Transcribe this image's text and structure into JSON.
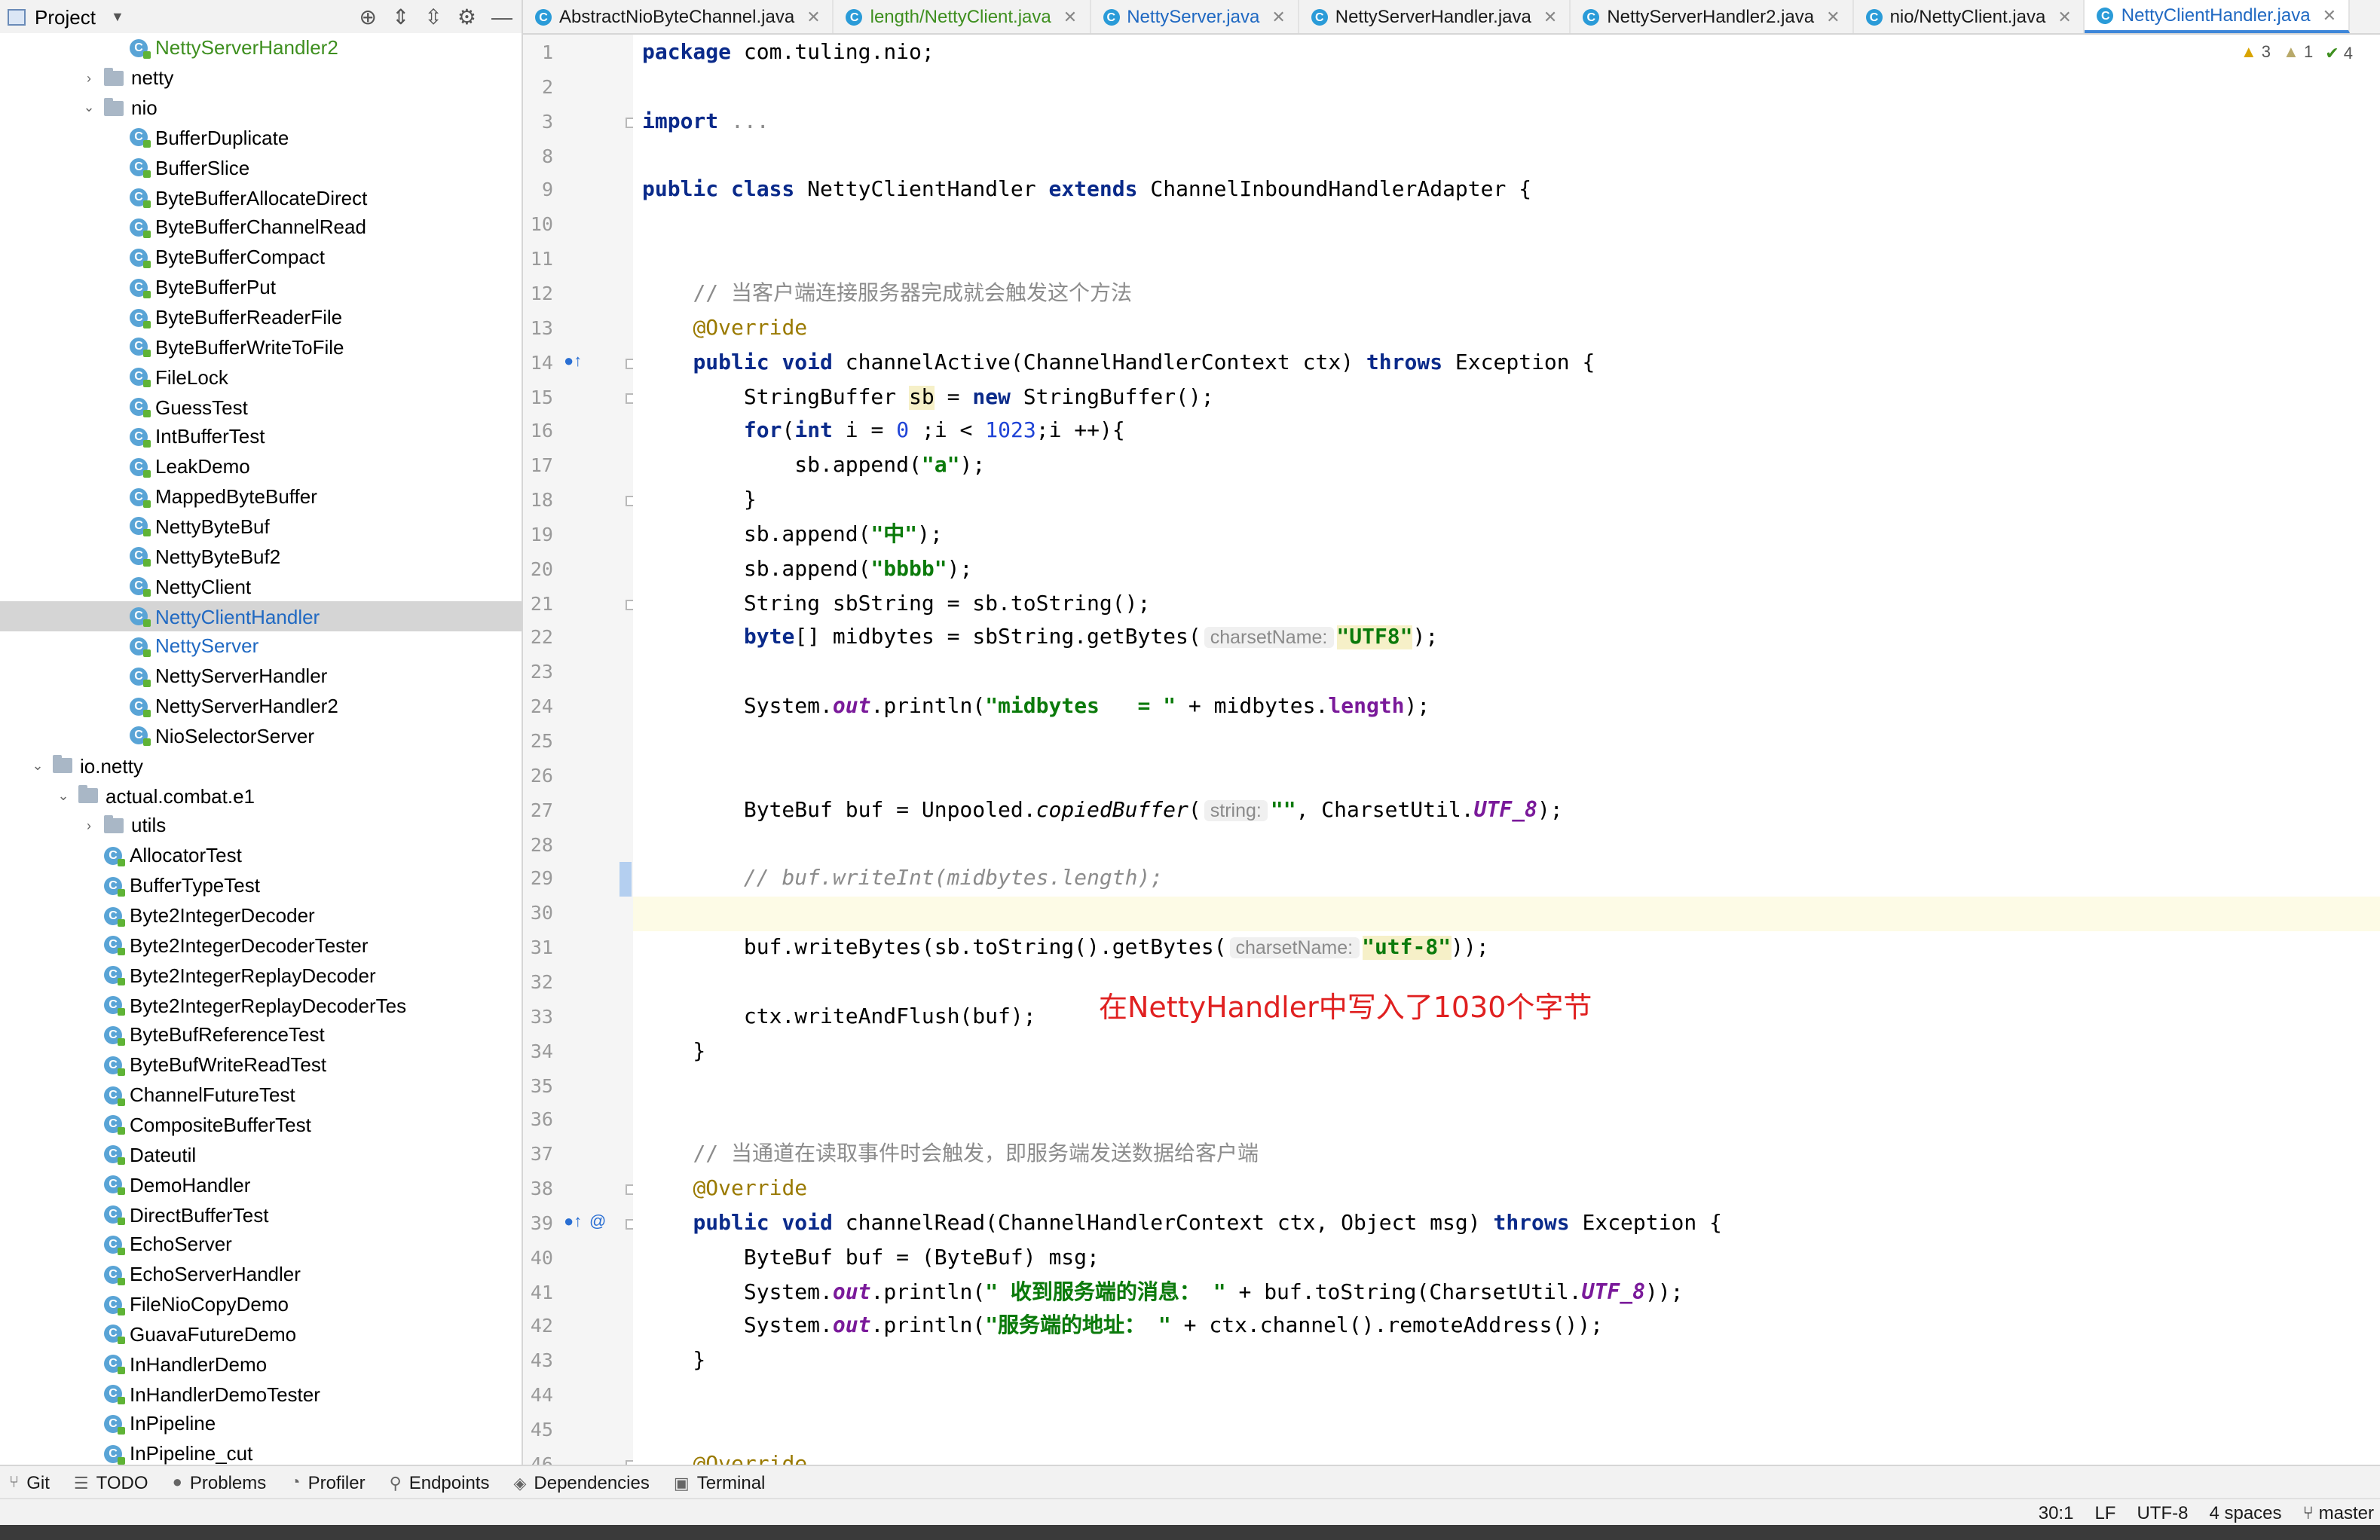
{
  "project_panel": {
    "title": "Project"
  },
  "tabs": [
    {
      "label": "AbstractNioByteChannel.java",
      "color": "normal"
    },
    {
      "label": "length/NettyClient.java",
      "color": "green"
    },
    {
      "label": "NettyServer.java",
      "color": "blue"
    },
    {
      "label": "NettyServerHandler.java",
      "color": "normal"
    },
    {
      "label": "NettyServerHandler2.java",
      "color": "normal"
    },
    {
      "label": "nio/NettyClient.java",
      "color": "normal"
    },
    {
      "label": "NettyClientHandler.java",
      "color": "active"
    }
  ],
  "tree": [
    {
      "label": "NettyServerHandler2",
      "kind": "class",
      "depth": 4,
      "color": "green"
    },
    {
      "label": "netty",
      "kind": "folder",
      "depth": 3,
      "arrow": "collapsed"
    },
    {
      "label": "nio",
      "kind": "folder",
      "depth": 3,
      "arrow": "expanded"
    },
    {
      "label": "BufferDuplicate",
      "kind": "class",
      "depth": 4
    },
    {
      "label": "BufferSlice",
      "kind": "class",
      "depth": 4
    },
    {
      "label": "ByteBufferAllocateDirect",
      "kind": "class",
      "depth": 4
    },
    {
      "label": "ByteBufferChannelRead",
      "kind": "class",
      "depth": 4
    },
    {
      "label": "ByteBufferCompact",
      "kind": "class",
      "depth": 4
    },
    {
      "label": "ByteBufferPut",
      "kind": "class",
      "depth": 4
    },
    {
      "label": "ByteBufferReaderFile",
      "kind": "class",
      "depth": 4
    },
    {
      "label": "ByteBufferWriteToFile",
      "kind": "class",
      "depth": 4
    },
    {
      "label": "FileLock",
      "kind": "class",
      "depth": 4
    },
    {
      "label": "GuessTest",
      "kind": "class",
      "depth": 4
    },
    {
      "label": "IntBufferTest",
      "kind": "class",
      "depth": 4
    },
    {
      "label": "LeakDemo",
      "kind": "class",
      "depth": 4
    },
    {
      "label": "MappedByteBuffer",
      "kind": "class",
      "depth": 4
    },
    {
      "label": "NettyByteBuf",
      "kind": "class",
      "depth": 4
    },
    {
      "label": "NettyByteBuf2",
      "kind": "class",
      "depth": 4
    },
    {
      "label": "NettyClient",
      "kind": "class",
      "depth": 4
    },
    {
      "label": "NettyClientHandler",
      "kind": "class",
      "depth": 4,
      "color": "blue",
      "selected": true
    },
    {
      "label": "NettyServer",
      "kind": "class",
      "depth": 4,
      "color": "blue"
    },
    {
      "label": "NettyServerHandler",
      "kind": "class",
      "depth": 4
    },
    {
      "label": "NettyServerHandler2",
      "kind": "class",
      "depth": 4
    },
    {
      "label": "NioSelectorServer",
      "kind": "class",
      "depth": 4
    },
    {
      "label": "io.netty",
      "kind": "folder",
      "depth": 1,
      "arrow": "expanded"
    },
    {
      "label": "actual.combat.e1",
      "kind": "folder",
      "depth": 2,
      "arrow": "expanded"
    },
    {
      "label": "utils",
      "kind": "folder",
      "depth": 3,
      "arrow": "collapsed"
    },
    {
      "label": "AllocatorTest",
      "kind": "class",
      "depth": 3
    },
    {
      "label": "BufferTypeTest",
      "kind": "class",
      "depth": 3
    },
    {
      "label": "Byte2IntegerDecoder",
      "kind": "class",
      "depth": 3
    },
    {
      "label": "Byte2IntegerDecoderTester",
      "kind": "class",
      "depth": 3
    },
    {
      "label": "Byte2IntegerReplayDecoder",
      "kind": "class",
      "depth": 3
    },
    {
      "label": "Byte2IntegerReplayDecoderTes",
      "kind": "class",
      "depth": 3
    },
    {
      "label": "ByteBufReferenceTest",
      "kind": "class",
      "depth": 3
    },
    {
      "label": "ByteBufWriteReadTest",
      "kind": "class",
      "depth": 3
    },
    {
      "label": "ChannelFutureTest",
      "kind": "class",
      "depth": 3
    },
    {
      "label": "CompositeBufferTest",
      "kind": "class",
      "depth": 3
    },
    {
      "label": "Dateutil",
      "kind": "class",
      "depth": 3
    },
    {
      "label": "DemoHandler",
      "kind": "class",
      "depth": 3
    },
    {
      "label": "DirectBufferTest",
      "kind": "class",
      "depth": 3
    },
    {
      "label": "EchoServer",
      "kind": "class",
      "depth": 3
    },
    {
      "label": "EchoServerHandler",
      "kind": "class",
      "depth": 3
    },
    {
      "label": "FileNioCopyDemo",
      "kind": "class",
      "depth": 3
    },
    {
      "label": "GuavaFutureDemo",
      "kind": "class",
      "depth": 3
    },
    {
      "label": "InHandlerDemo",
      "kind": "class",
      "depth": 3
    },
    {
      "label": "InHandlerDemoTester",
      "kind": "class",
      "depth": 3
    },
    {
      "label": "InPipeline",
      "kind": "class",
      "depth": 3
    },
    {
      "label": "InPipeline_cut",
      "kind": "class",
      "depth": 3
    }
  ],
  "code_lines": [
    {
      "n": "1",
      "html": "<span class=\"kw\">package</span> com.tuling.nio;"
    },
    {
      "n": "2",
      "html": ""
    },
    {
      "n": "3",
      "html": "<span class=\"kw\">import</span> <span class=\"dim\">...</span>"
    },
    {
      "n": "8",
      "html": ""
    },
    {
      "n": "9",
      "html": "<span class=\"kw\">public class</span> NettyClientHandler <span class=\"kw\">extends</span> ChannelInboundHandlerAdapter {"
    },
    {
      "n": "10",
      "html": ""
    },
    {
      "n": "11",
      "html": ""
    },
    {
      "n": "12",
      "html": "    <span class=\"comzh\">// 当客户端连接服务器完成就会触发这个方法</span>"
    },
    {
      "n": "13",
      "html": "    <span class=\"ann\">@Override</span>"
    },
    {
      "n": "14",
      "html": "    <span class=\"kw\">public void</span> channelActive(ChannelHandlerContext ctx) <span class=\"kw\">throws</span> Exception {"
    },
    {
      "n": "15",
      "html": "        StringBuffer <span class=\"hlbg\">sb</span> = <span class=\"kw\">new</span> StringBuffer();"
    },
    {
      "n": "16",
      "html": "        <span class=\"kw\">for</span>(<span class=\"kw\">int</span> i = <span class=\"num\">0</span> ;i &lt; <span class=\"num\">1023</span>;i ++){"
    },
    {
      "n": "17",
      "html": "            sb.append(<span class=\"str\">\"a\"</span>);"
    },
    {
      "n": "18",
      "html": "        }"
    },
    {
      "n": "19",
      "html": "        sb.append(<span class=\"str\">\"中\"</span>);"
    },
    {
      "n": "20",
      "html": "        sb.append(<span class=\"str\">\"bbbb\"</span>);"
    },
    {
      "n": "21",
      "html": "        String sbString = sb.toString();"
    },
    {
      "n": "22",
      "html": "        <span class=\"kw\">byte</span>[] midbytes = sbString.getBytes(<span class=\"hint\">charsetName:</span><span class=\"str hlbg\">\"UTF8\"</span>);"
    },
    {
      "n": "23",
      "html": ""
    },
    {
      "n": "24",
      "html": "        System.<span class=\"fld\">out</span>.println(<span class=\"str\">\"midbytes   = \"</span> + midbytes.<span class=\"fld\" style=\"font-style:normal\">length</span>);"
    },
    {
      "n": "25",
      "html": ""
    },
    {
      "n": "26",
      "html": ""
    },
    {
      "n": "27",
      "html": "        ByteBuf buf = Unpooled.<span class=\"ital\">copiedBuffer</span>(<span class=\"hint\">string:</span><span class=\"str\">\"\"</span>, CharsetUtil.<span class=\"fld\">UTF_8</span>);"
    },
    {
      "n": "28",
      "html": ""
    },
    {
      "n": "29",
      "html": "        <span class=\"com\">// buf.writeInt(midbytes.length);</span>"
    },
    {
      "n": "30",
      "html": "",
      "current": true
    },
    {
      "n": "31",
      "html": "        buf.writeBytes(sb.toString().getBytes(<span class=\"hint\">charsetName:</span><span class=\"str hlbg\">\"utf-8\"</span>));"
    },
    {
      "n": "32",
      "html": ""
    },
    {
      "n": "33",
      "html": "        ctx.writeAndFlush(buf);"
    },
    {
      "n": "34",
      "html": "    }"
    },
    {
      "n": "35",
      "html": ""
    },
    {
      "n": "36",
      "html": ""
    },
    {
      "n": "37",
      "html": "    <span class=\"comzh\">// 当通道在读取事件时会触发，即服务端发送数据给客户端</span>"
    },
    {
      "n": "38",
      "html": "    <span class=\"ann\">@Override</span>"
    },
    {
      "n": "39",
      "html": "    <span class=\"kw\">public void</span> channelRead(ChannelHandlerContext ctx, Object msg) <span class=\"kw\">throws</span> Exception {"
    },
    {
      "n": "40",
      "html": "        ByteBuf buf = (ByteBuf) msg;"
    },
    {
      "n": "41",
      "html": "        System.<span class=\"fld\">out</span>.println(<span class=\"str\">\" 收到服务端的消息： \"</span> + buf.toString(CharsetUtil.<span class=\"fld\">UTF_8</span>));"
    },
    {
      "n": "42",
      "html": "        System.<span class=\"fld\">out</span>.println(<span class=\"str\">\"服务端的地址： \"</span> + ctx.channel().remoteAddress());"
    },
    {
      "n": "43",
      "html": "    }"
    },
    {
      "n": "44",
      "html": ""
    },
    {
      "n": "45",
      "html": ""
    },
    {
      "n": "46",
      "html": "    <span class=\"ann\">@Override</span>"
    }
  ],
  "inspections": {
    "warnings": "3",
    "weak_warnings": "1",
    "ok": "4"
  },
  "annotation_note": "在NettyHandler中写入了1030个字节",
  "toolwindows": [
    {
      "label": "Git",
      "icon": "git-icon"
    },
    {
      "label": "TODO",
      "icon": "todo-icon"
    },
    {
      "label": "Problems",
      "icon": "problems-icon"
    },
    {
      "label": "Profiler",
      "icon": "profiler-icon"
    },
    {
      "label": "Endpoints",
      "icon": "endpoints-icon"
    },
    {
      "label": "Dependencies",
      "icon": "dependencies-icon"
    },
    {
      "label": "Terminal",
      "icon": "terminal-icon"
    }
  ],
  "status": {
    "position": "30:1",
    "line_sep": "LF",
    "encoding": "UTF-8",
    "indent": "4 spaces",
    "branch": "master"
  }
}
